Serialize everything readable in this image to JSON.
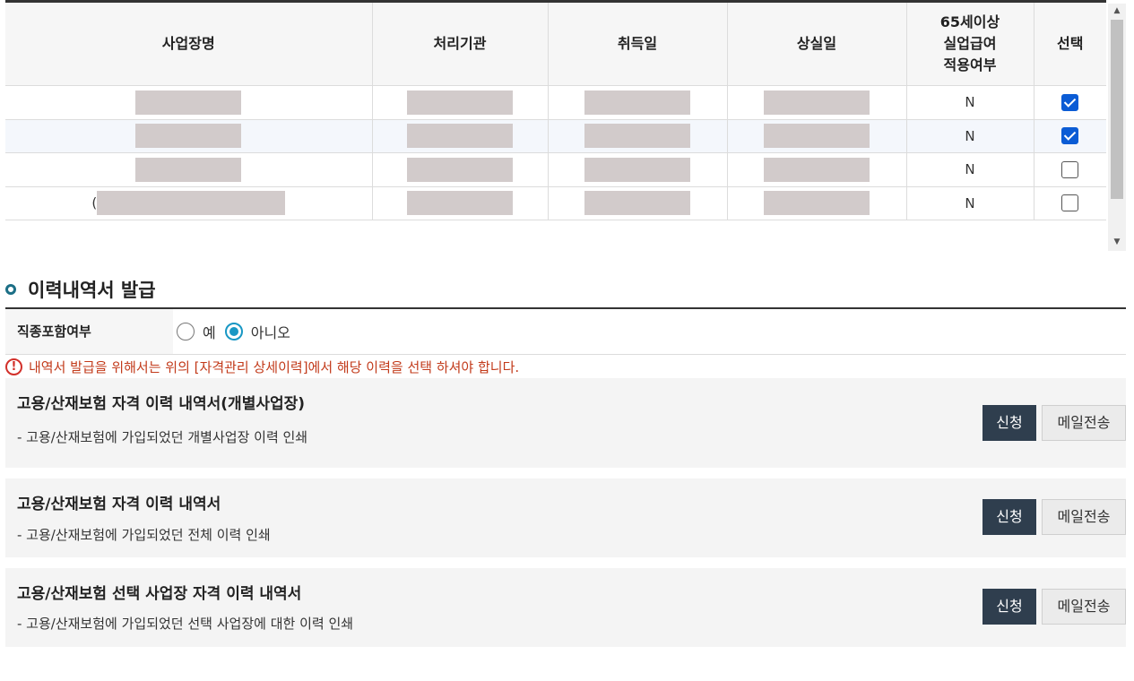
{
  "table": {
    "headers": [
      "사업장명",
      "처리기관",
      "취득일",
      "상실일",
      "65세이상\n실업급여\n적용여부",
      "선택"
    ],
    "rows": [
      {
        "prefix": "",
        "n": "N",
        "checked": true
      },
      {
        "prefix": "",
        "n": "N",
        "checked": true
      },
      {
        "prefix": "",
        "n": "N",
        "checked": false
      },
      {
        "prefix": "(",
        "n": "N",
        "checked": false
      }
    ]
  },
  "section": {
    "title": "이력내역서 발급",
    "option_label": "직종포함여부",
    "radio_yes": "예",
    "radio_no": "아니오",
    "selected": "no",
    "warning": "내역서 발급을 위해서는 위의 [자격관리 상세이력]에서 해당 이력을 선택 하셔야 합니다."
  },
  "cards": [
    {
      "title": "고용/산재보험 자격 이력 내역서(개별사업장)",
      "desc": "- 고용/산재보험에 가입되었던 개별사업장 이력 인쇄",
      "apply": "신청",
      "mail": "메일전송"
    },
    {
      "title": "고용/산재보험 자격 이력 내역서",
      "desc": "- 고용/산재보험에 가입되었던 전체 이력 인쇄",
      "apply": "신청",
      "mail": "메일전송"
    },
    {
      "title": "고용/산재보험 선택 사업장 자격 이력 내역서",
      "desc": "- 고용/산재보험에 가입되었던 선택 사업장에 대한 이력 인쇄",
      "apply": "신청",
      "mail": "메일전송"
    }
  ],
  "colors": {
    "apply_button": "#2f3e4e",
    "radio_accent": "#1897c4",
    "warning": "#c23a1a",
    "checkbox": "#0b5cd5"
  }
}
